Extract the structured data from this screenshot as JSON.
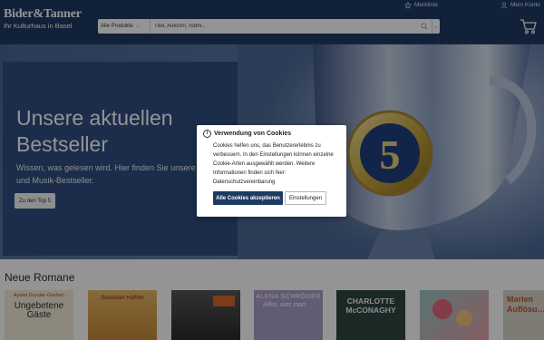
{
  "brand": {
    "name": "Bider&Tanner",
    "subtitle": "Ihr Kulturhaus in Basel"
  },
  "header": {
    "wishlist_label": "Merkliste",
    "account_label": "Mein Konto",
    "search": {
      "category": "Alle Produkte",
      "placeholder": "Titel, Autor/in, ISBN..."
    }
  },
  "hero": {
    "title": "Unsere aktuellen Bestseller",
    "text": "Wissen, was gelesen wird. Hier finden Sie unsere Buch- und Musik-Bestseller.",
    "button_label": "Zu den Top 5",
    "trophy_number": "5"
  },
  "section": {
    "title": "Neue Romane"
  },
  "books": [
    {
      "author": "Ayelet Gundar-Goshen",
      "title": "Ungebetene Gäste",
      "bg": "#f3ead8"
    },
    {
      "author": "Sebastian Haffner",
      "title": "",
      "bg": "#e0a548"
    },
    {
      "author": "",
      "title": "",
      "bg": "#3d3d3d"
    },
    {
      "author": "ALENA SCHRÖDER",
      "title": "Alles, was man …",
      "bg": "#a99ec8"
    },
    {
      "author": "CHARLOTTE",
      "title": "McCONAGHY",
      "bg": "#2e4543"
    },
    {
      "author": "",
      "title": "",
      "bg": "#9cc7c8"
    },
    {
      "author": "Marlen",
      "title": "Auflösu…",
      "bg": "#d9d4ca"
    }
  ],
  "cookie_dialog": {
    "title": "Verwendung von Cookies",
    "body": "Cookies helfen uns, das Benutzererlebnis zu verbessern. In den Einstellungen können einzelne Cookie-Arten ausgewählt werden. Weitere Informationen finden sich hier: Datenschutzvereinbarung",
    "accept_label": "Alle Cookies akzeptieren",
    "settings_label": "Einstellungen"
  },
  "colors": {
    "brand": "#1c3a63",
    "hero_panel": "#2f4f80",
    "overlay": "rgba(0,0,0,0.42)"
  },
  "icons": [
    "star-icon",
    "user-icon",
    "search-icon",
    "cart-icon",
    "info-icon"
  ]
}
